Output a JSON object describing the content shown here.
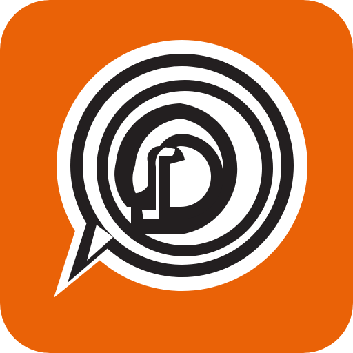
{
  "app_icon": {
    "icon": "chat-bubble-d-logo-icon",
    "colors": {
      "background": "#EA6207",
      "ring": "#231F20",
      "bubble_fill": "#FFFFFF"
    }
  }
}
